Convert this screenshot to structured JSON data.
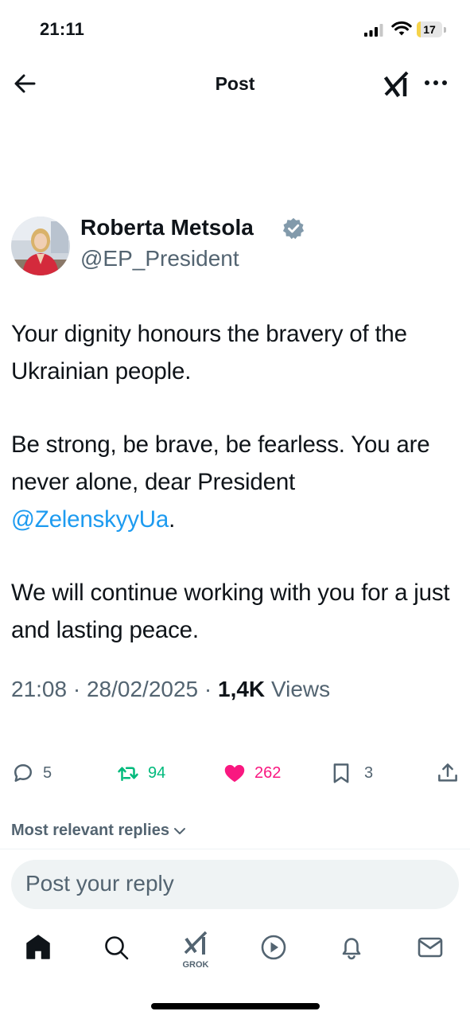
{
  "status_bar": {
    "time": "21:11",
    "battery": "17",
    "battery_level": 0.17
  },
  "nav": {
    "title": "Post",
    "back_icon": "arrow-left-icon",
    "grok_icon": "grok-icon",
    "more_icon": "ellipsis-icon"
  },
  "post": {
    "author_name": "Roberta Metsola",
    "handle": "@EP_President",
    "verified": true,
    "body": {
      "p1": "Your dignity honours the bravery of the Ukrainian people.",
      "p2_text": "Be strong, be brave, be fearless. You are never alone, dear President",
      "p2_mention": "@ZelenskyyUa",
      "p2_end": ".",
      "p3": "We will continue working with you for a just and lasting peace."
    },
    "time": "21:08",
    "date": "28/02/2025",
    "separator": "·",
    "views_count": "1,4K",
    "views_label": "Views",
    "replies": "5",
    "reposts": "94",
    "likes": "262",
    "bookmarks": "3"
  },
  "replies_section": {
    "sort_label": "Most relevant replies",
    "reply_placeholder": "Post your reply"
  },
  "tab_bar": {
    "grok_label": "GROK"
  },
  "colors": {
    "accent": "#1d9bf0",
    "repost": "#00ba7c",
    "like": "#f91880",
    "muted": "#536471",
    "verified": "#829aab"
  }
}
